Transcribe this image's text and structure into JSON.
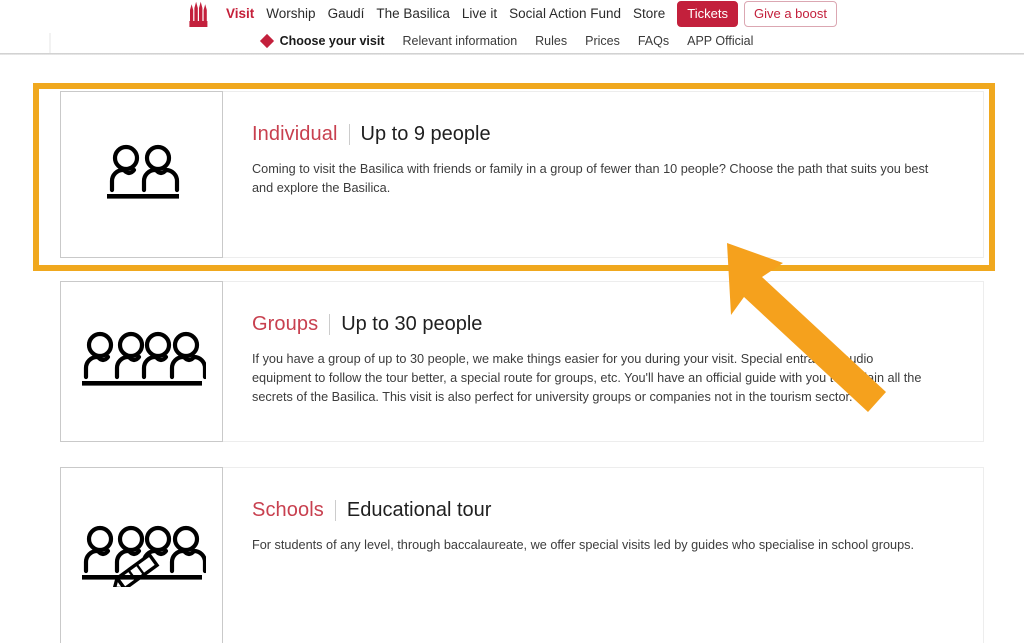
{
  "header": {
    "logo_icon": "sagrada-familia-towers-icon",
    "brand_color": "#c3203c",
    "primary_nav": [
      {
        "label": "Visit",
        "active": true
      },
      {
        "label": "Worship",
        "active": false
      },
      {
        "label": "Gaudí",
        "active": false
      },
      {
        "label": "The Basilica",
        "active": false
      },
      {
        "label": "Live it",
        "active": false
      },
      {
        "label": "Social Action Fund",
        "active": false
      },
      {
        "label": "Store",
        "active": false
      }
    ],
    "buttons": [
      {
        "label": "Tickets",
        "style": "filled"
      },
      {
        "label": "Give a boost",
        "style": "outline"
      }
    ],
    "secondary_nav": [
      {
        "label": "Choose your visit",
        "active": true
      },
      {
        "label": "Relevant information",
        "active": false
      },
      {
        "label": "Rules",
        "active": false
      },
      {
        "label": "Prices",
        "active": false
      },
      {
        "label": "FAQs",
        "active": false
      },
      {
        "label": "APP Official",
        "active": false
      }
    ]
  },
  "cards": [
    {
      "title": "Individual",
      "subtitle": "Up to 9 people",
      "description": "Coming to visit the Basilica with friends or family in a group of fewer than 10 people? Choose the path that suits you best and explore the Basilica.",
      "icon": "two-people-icon",
      "people_count": 2,
      "has_pencil": false,
      "highlighted": true
    },
    {
      "title": "Groups",
      "subtitle": "Up to 30 people",
      "description": "If you have a group of up to 30 people, we make things easier for you during your visit. Special entrance, audio equipment to follow the tour better, a special route for groups, etc. You'll have an official guide with you to explain all the secrets of the Basilica. This visit is also perfect for university groups or companies not in the tourism sector.",
      "icon": "four-people-icon",
      "people_count": 4,
      "has_pencil": false,
      "highlighted": false
    },
    {
      "title": "Schools",
      "subtitle": "Educational tour",
      "description": "For students of any level, through baccalaureate, we offer special visits led by guides who specialise in school groups.",
      "icon": "four-people-pencil-icon",
      "people_count": 4,
      "has_pencil": true,
      "highlighted": false
    }
  ],
  "annotations": {
    "highlight_color": "#f0a81e",
    "highlight_target": "Individual",
    "arrow_color": "#f5a11d",
    "arrow_direction": "up-left",
    "arrow_points_at": "individual-card"
  }
}
